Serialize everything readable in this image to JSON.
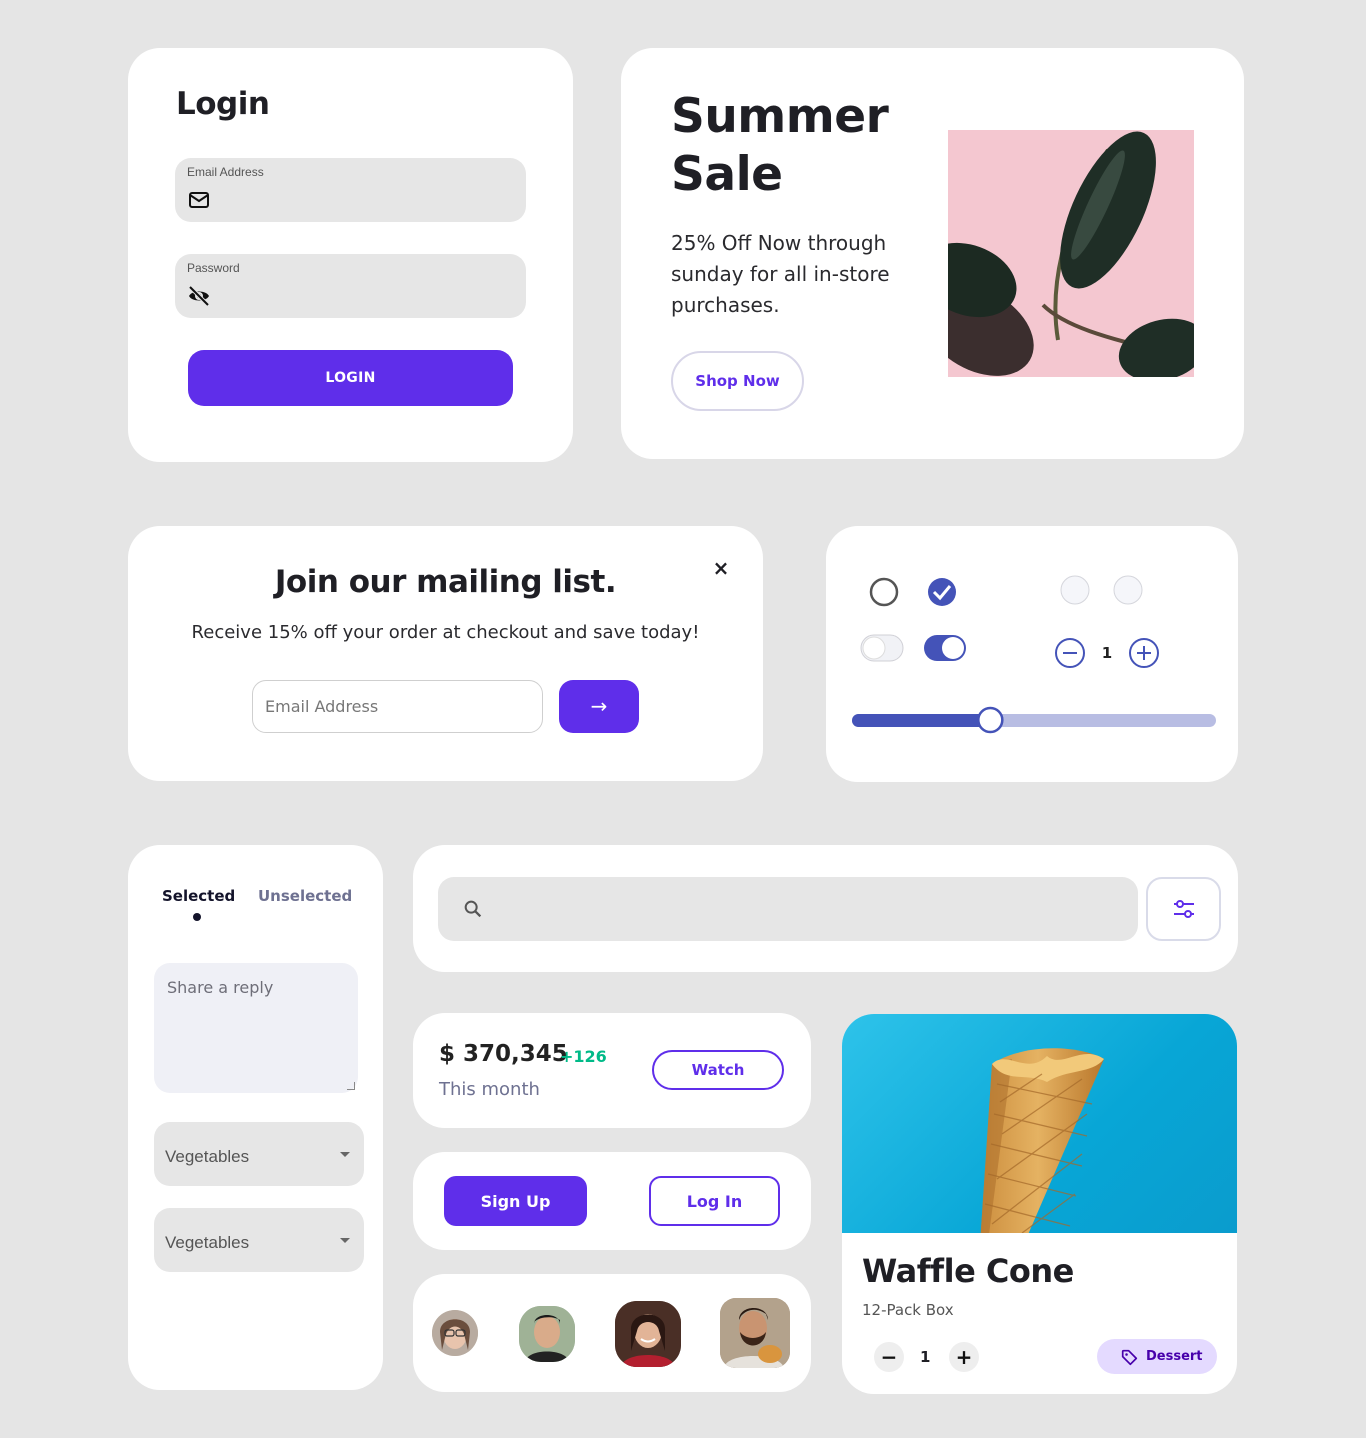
{
  "login": {
    "title": "Login",
    "email_label": "Email Address",
    "password_label": "Password",
    "button_label": "LOGIN"
  },
  "sale": {
    "title": "Summer Sale",
    "description": "25% Off Now through sunday for all in-store purchases.",
    "button_label": "Shop Now"
  },
  "mailing": {
    "title": "Join our mailing list.",
    "subtitle": "Receive 15% off your order at checkout and save today!",
    "close_icon": "×",
    "email_placeholder": "Email Address",
    "submit_icon": "→"
  },
  "controls": {
    "radio_unchecked": false,
    "radio_checked": true,
    "toggle_off": false,
    "toggle_on": true,
    "stepper_value": "1",
    "slider_value": 0.38,
    "accent_color": "#4453b8",
    "track_color": "#b8bde3"
  },
  "tabs": {
    "selected": "Selected",
    "unselected": "Unselected",
    "reply_placeholder": "Share a reply",
    "select_1": "Vegetables",
    "select_2": "Vegetables"
  },
  "stats": {
    "amount": "$ 370,345",
    "delta": "+126",
    "label": "This month",
    "button_label": "Watch",
    "delta_color": "#00ba88"
  },
  "auth": {
    "signup_label": "Sign Up",
    "login_label": "Log In"
  },
  "product": {
    "title": "Waffle Cone",
    "subtitle": "12-Pack Box",
    "minus": "−",
    "quantity": "1",
    "plus": "+",
    "badge": "Dessert"
  },
  "colors": {
    "primary": "#5f2eea",
    "background": "#e5e5e5"
  }
}
